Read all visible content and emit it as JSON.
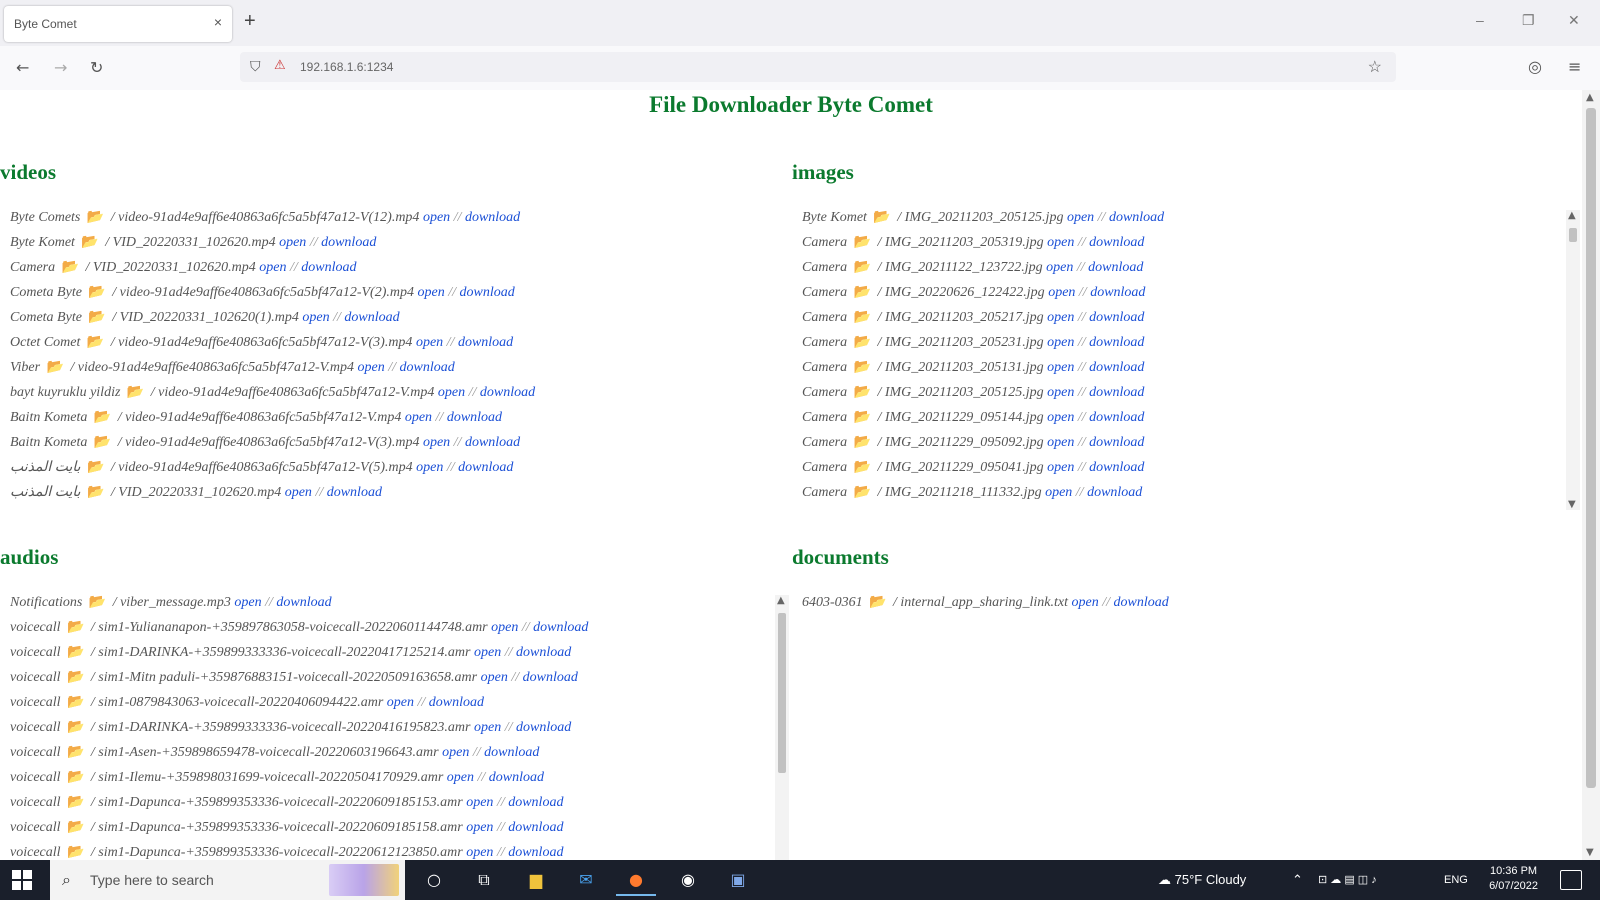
{
  "browser": {
    "tab_title": "Byte Comet",
    "tab_close": "×",
    "new_tab": "+",
    "url": "192.168.1.6:1234",
    "win_min": "–",
    "win_restore": "❐",
    "win_close": "✕"
  },
  "page": {
    "title": "File Downloader Byte Comet",
    "link_open": "open",
    "link_sep": " // ",
    "link_download": "download"
  },
  "videos": {
    "title": "videos",
    "items": [
      {
        "sender": "Byte Comets",
        "file": "/ video-91ad4e9aff6e40863a6fc5a5bf47a12-V(12).mp4"
      },
      {
        "sender": "Byte Komet",
        "file": "/ VID_20220331_102620.mp4"
      },
      {
        "sender": "Camera",
        "file": "/ VID_20220331_102620.mp4"
      },
      {
        "sender": "Cometa Byte",
        "file": "/ video-91ad4e9aff6e40863a6fc5a5bf47a12-V(2).mp4"
      },
      {
        "sender": "Cometa Byte",
        "file": "/ VID_20220331_102620(1).mp4"
      },
      {
        "sender": "Octet Comet",
        "file": "/ video-91ad4e9aff6e40863a6fc5a5bf47a12-V(3).mp4"
      },
      {
        "sender": "Viber",
        "file": "/ video-91ad4e9aff6e40863a6fc5a5bf47a12-V.mp4"
      },
      {
        "sender": "bayt kuyruklu yildiz",
        "file": "/ video-91ad4e9aff6e40863a6fc5a5bf47a12-V.mp4"
      },
      {
        "sender": "Baitn Kometa",
        "file": "/ video-91ad4e9aff6e40863a6fc5a5bf47a12-V.mp4"
      },
      {
        "sender": "Baitn Kometa",
        "file": "/ video-91ad4e9aff6e40863a6fc5a5bf47a12-V(3).mp4"
      },
      {
        "sender": "بايت المذنب",
        "file": "/ video-91ad4e9aff6e40863a6fc5a5bf47a12-V(5).mp4"
      },
      {
        "sender": "بايت المذنب",
        "file": "/ VID_20220331_102620.mp4"
      }
    ]
  },
  "images": {
    "title": "images",
    "items": [
      {
        "sender": "Byte Komet",
        "file": "/ IMG_20211203_205125.jpg"
      },
      {
        "sender": "Camera",
        "file": "/ IMG_20211203_205319.jpg"
      },
      {
        "sender": "Camera",
        "file": "/ IMG_20211122_123722.jpg"
      },
      {
        "sender": "Camera",
        "file": "/ IMG_20220626_122422.jpg"
      },
      {
        "sender": "Camera",
        "file": "/ IMG_20211203_205217.jpg"
      },
      {
        "sender": "Camera",
        "file": "/ IMG_20211203_205231.jpg"
      },
      {
        "sender": "Camera",
        "file": "/ IMG_20211203_205131.jpg"
      },
      {
        "sender": "Camera",
        "file": "/ IMG_20211203_205125.jpg"
      },
      {
        "sender": "Camera",
        "file": "/ IMG_20211229_095144.jpg"
      },
      {
        "sender": "Camera",
        "file": "/ IMG_20211229_095092.jpg"
      },
      {
        "sender": "Camera",
        "file": "/ IMG_20211229_095041.jpg"
      },
      {
        "sender": "Camera",
        "file": "/ IMG_20211218_111332.jpg"
      }
    ]
  },
  "audios": {
    "title": "audios",
    "items": [
      {
        "sender": "Notifications",
        "file": "/ viber_message.mp3"
      },
      {
        "sender": "voicecall",
        "file": "/ sim1-Yuliananapon-+359897863058-voicecall-20220601144748.amr"
      },
      {
        "sender": "voicecall",
        "file": "/ sim1-DARINKA-+359899333336-voicecall-20220417125214.amr"
      },
      {
        "sender": "voicecall",
        "file": "/ sim1-Mitn paduli-+359876883151-voicecall-20220509163658.amr"
      },
      {
        "sender": "voicecall",
        "file": "/ sim1-0879843063-voicecall-20220406094422.amr"
      },
      {
        "sender": "voicecall",
        "file": "/ sim1-DARINKA-+359899333336-voicecall-20220416195823.amr"
      },
      {
        "sender": "voicecall",
        "file": "/ sim1-Asen-+359898659478-voicecall-20220603196643.amr"
      },
      {
        "sender": "voicecall",
        "file": "/ sim1-Ilemu-+359898031699-voicecall-20220504170929.amr"
      },
      {
        "sender": "voicecall",
        "file": "/ sim1-Dapunca-+359899353336-voicecall-20220609185153.amr"
      },
      {
        "sender": "voicecall",
        "file": "/ sim1-Dapunca-+359899353336-voicecall-20220609185158.amr"
      },
      {
        "sender": "voicecall",
        "file": "/ sim1-Dapunca-+359899353336-voicecall-20220612123850.amr"
      }
    ]
  },
  "documents": {
    "title": "documents",
    "items": [
      {
        "sender": "6403-0361",
        "file": "/ internal_app_sharing_link.txt"
      }
    ]
  },
  "taskbar": {
    "search_placeholder": "Type here to search",
    "weather": "75°F Cloudy",
    "lang": "ENG",
    "time": "10:36 PM",
    "date": "6/07/2022"
  }
}
